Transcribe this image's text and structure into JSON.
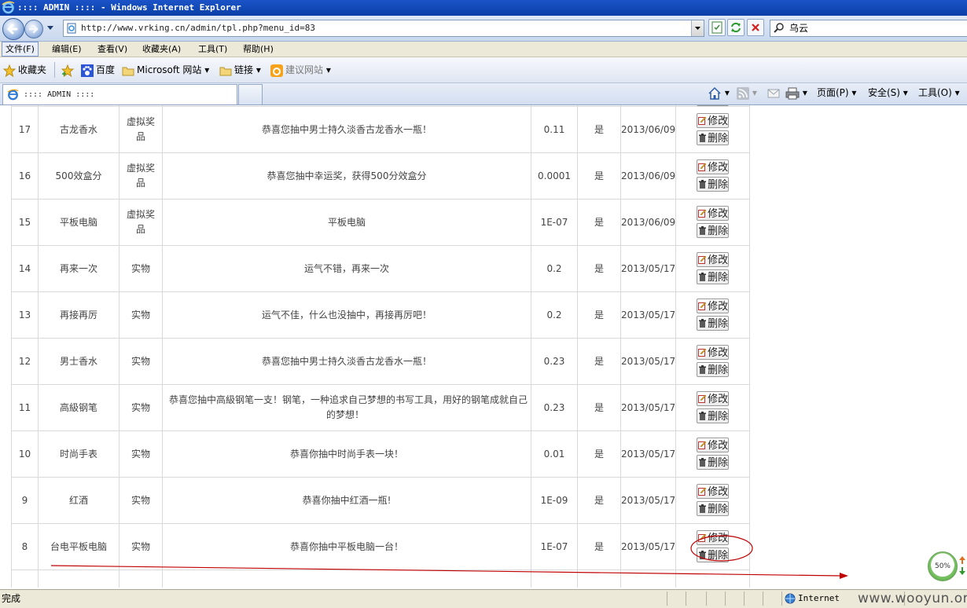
{
  "window": {
    "title": ":::: ADMIN :::: - Windows Internet Explorer"
  },
  "address_bar": {
    "url": "http://www.vrking.cn/admin/tpl.php?menu_id=83"
  },
  "search": {
    "value": "乌云"
  },
  "menu": [
    "文件(F)",
    "编辑(E)",
    "查看(V)",
    "收藏夹(A)",
    "工具(T)",
    "帮助(H)"
  ],
  "favorites": {
    "label": "收藏夹",
    "items": [
      "百度",
      "Microsoft 网站",
      "链接",
      "建议网站"
    ]
  },
  "tab": {
    "label": ":::: ADMIN ::::"
  },
  "command_bar": [
    "页面(P)",
    "安全(S)",
    "工具(O)"
  ],
  "table": {
    "edit_label": "修改",
    "delete_label": "删除",
    "cut_top_button": "删除",
    "rows": [
      {
        "id": "17",
        "name": "古龙香水",
        "type": "虚拟奖品",
        "desc": "恭喜您抽中男士持久淡香古龙香水一瓶！",
        "prob": "0.11",
        "enabled": "是",
        "date": "2013/06/09"
      },
      {
        "id": "16",
        "name": "500效盒分",
        "type": "虚拟奖品",
        "desc": "恭喜您抽中幸运奖，获得500分效盒分",
        "prob": "0.0001",
        "enabled": "是",
        "date": "2013/06/09"
      },
      {
        "id": "15",
        "name": "平板电脑",
        "type": "虚拟奖品",
        "desc": "平板电脑",
        "prob": "1E-07",
        "enabled": "是",
        "date": "2013/06/09"
      },
      {
        "id": "14",
        "name": "再来一次",
        "type": "实物",
        "desc": "运气不错，再来一次",
        "prob": "0.2",
        "enabled": "是",
        "date": "2013/05/17"
      },
      {
        "id": "13",
        "name": "再接再厉",
        "type": "实物",
        "desc": "运气不佳，什么也没抽中，再接再厉吧！",
        "prob": "0.2",
        "enabled": "是",
        "date": "2013/05/17"
      },
      {
        "id": "12",
        "name": "男士香水",
        "type": "实物",
        "desc": "恭喜您抽中男士持久淡香古龙香水一瓶！",
        "prob": "0.23",
        "enabled": "是",
        "date": "2013/05/17"
      },
      {
        "id": "11",
        "name": "高級钢笔",
        "type": "实物",
        "desc": "恭喜您抽中高級钢笔一支！钢笔，一种追求自己梦想的书写工具，用好的钢笔成就自己的梦想！",
        "prob": "0.23",
        "enabled": "是",
        "date": "2013/05/17"
      },
      {
        "id": "10",
        "name": "时尚手表",
        "type": "实物",
        "desc": "恭喜你抽中时尚手表一块！",
        "prob": "0.01",
        "enabled": "是",
        "date": "2013/05/17"
      },
      {
        "id": "9",
        "name": "红酒",
        "type": "实物",
        "desc": "恭喜你抽中红酒一瓶!",
        "prob": "1E-09",
        "enabled": "是",
        "date": "2013/05/17"
      },
      {
        "id": "8",
        "name": "台电平板电脑",
        "type": "实物",
        "desc": "恭喜你抽中平板电脑一台！",
        "prob": "1E-07",
        "enabled": "是",
        "date": "2013/05/17"
      }
    ]
  },
  "gauge": {
    "value": "50%"
  },
  "status": {
    "text": "完成",
    "zone": "Internet"
  },
  "watermark": "www.wooyun.org",
  "colors": {
    "annotation": "#c00000",
    "title_bar": "#0b3fa7"
  }
}
